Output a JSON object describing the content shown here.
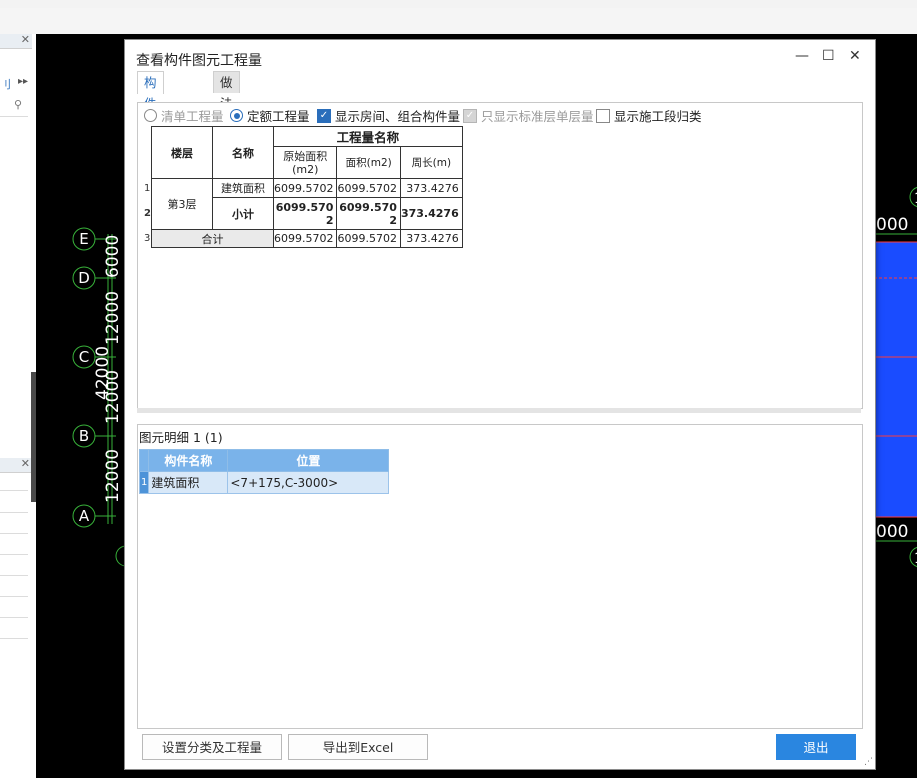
{
  "host": {
    "left_stub": "刂",
    "left_arrows": "▸▸",
    "axis_labels": [
      "E",
      "D",
      "C",
      "B",
      "A"
    ],
    "axis_dims": [
      "6000",
      "12000",
      "12000",
      "12000"
    ],
    "overlap_dim": "42000",
    "right_dims": [
      "000",
      "000"
    ],
    "right_marks": [
      "1",
      "1"
    ],
    "colors": {
      "canvas": "#000000",
      "axis": "#38b23a",
      "blue_fill": "#1a4cff",
      "red_line": "#ff3b3b"
    }
  },
  "dialog": {
    "title": "查看构件图元工程量",
    "window_controls": {
      "minimize": "—",
      "maximize": "☐",
      "close": "✕"
    },
    "tabs": [
      {
        "label": "构件工程量",
        "active": true
      },
      {
        "label": "做法工程量",
        "active": false
      }
    ],
    "options": [
      {
        "type": "radio",
        "label": "清单工程量",
        "checked": false,
        "disabled": true
      },
      {
        "type": "radio",
        "label": "定额工程量",
        "checked": true,
        "disabled": false
      },
      {
        "type": "checkbox",
        "label": "显示房间、组合构件量",
        "checked": true,
        "disabled": false
      },
      {
        "type": "checkbox",
        "label": "只显示标准层单层量",
        "checked": true,
        "disabled": true
      },
      {
        "type": "checkbox",
        "label": "显示施工段归类",
        "checked": false,
        "disabled": false
      }
    ],
    "quantity_table": {
      "header_floor": "楼层",
      "header_name": "名称",
      "header_group": "工程量名称",
      "columns": [
        "原始面积(m2)",
        "面积(m2)",
        "周长(m)"
      ],
      "row_numbers": [
        "1",
        "2",
        "3"
      ],
      "floor": "第3层",
      "rows": [
        {
          "name": "建筑面积",
          "values": [
            "6099.5702",
            "6099.5702",
            "373.4276"
          ]
        },
        {
          "name": "小计",
          "values": [
            "6099.5702",
            "6099.5702",
            "373.4276"
          ]
        }
      ],
      "total_label": "合计",
      "total_values": [
        "6099.5702",
        "6099.5702",
        "373.4276"
      ]
    },
    "detail": {
      "label": "图元明细 1 (1)",
      "columns": [
        "构件名称",
        "位置"
      ],
      "rows": [
        {
          "num": "1",
          "name": "建筑面积",
          "position": "<7+175,C-3000>"
        }
      ]
    },
    "buttons": {
      "classify": "设置分类及工程量",
      "export": "导出到Excel",
      "exit": "退出"
    }
  }
}
